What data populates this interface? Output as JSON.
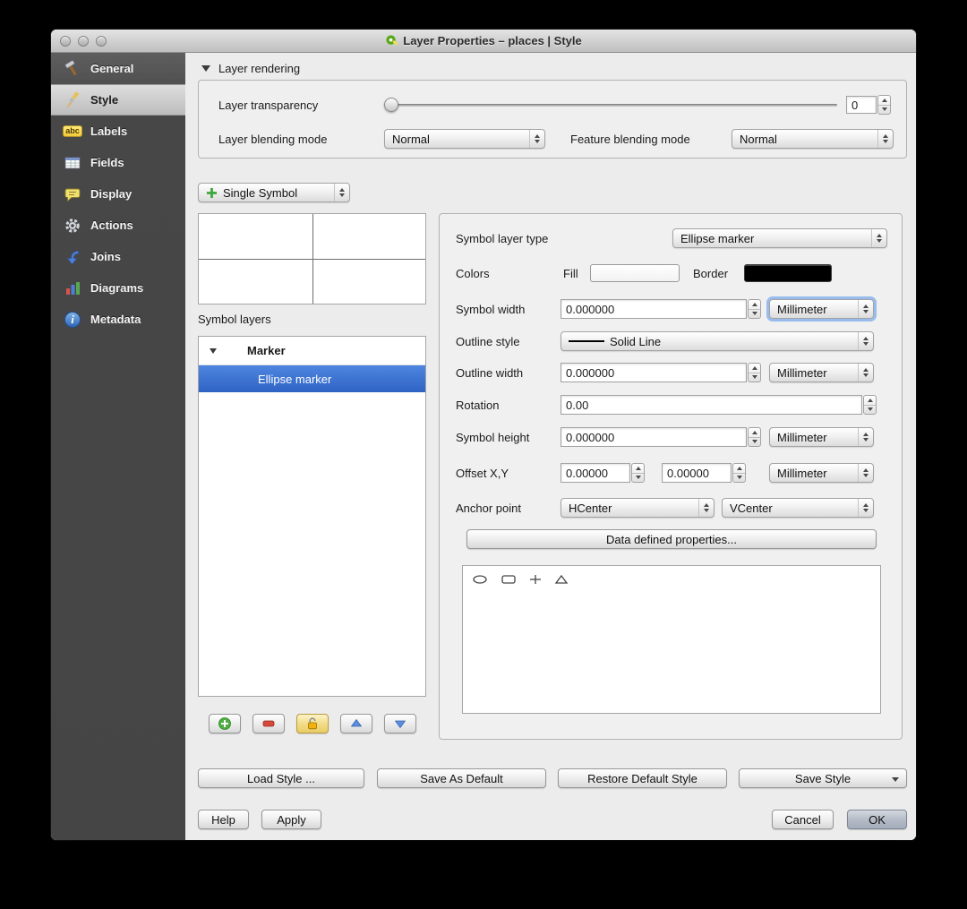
{
  "colors": {
    "selection_blue": "#3a76d8",
    "sidebar_bg": "#4a4a4a",
    "fill_swatch": "#ffffff",
    "border_swatch": "#000000"
  },
  "titlebar": {
    "title": "Layer Properties – places | Style"
  },
  "sidebar": {
    "items": [
      {
        "label": "General"
      },
      {
        "label": "Style"
      },
      {
        "label": "Labels",
        "icon_text": "abc"
      },
      {
        "label": "Fields"
      },
      {
        "label": "Display"
      },
      {
        "label": "Actions"
      },
      {
        "label": "Joins"
      },
      {
        "label": "Diagrams"
      },
      {
        "label": "Metadata",
        "icon_text": "i"
      }
    ]
  },
  "layer_rendering": {
    "header": "Layer rendering",
    "transparency": {
      "label": "Layer transparency",
      "value": "0"
    },
    "layer_blending": {
      "label": "Layer blending mode",
      "value": "Normal"
    },
    "feature_blending": {
      "label": "Feature blending mode",
      "value": "Normal"
    }
  },
  "symbol_section": {
    "renderer": "Single Symbol",
    "symbol_layers_label": "Symbol layers",
    "tree": {
      "group_label": "Marker",
      "selected_item": "Ellipse marker"
    }
  },
  "properties": {
    "symbol_layer_type": {
      "label": "Symbol layer type",
      "value": "Ellipse marker"
    },
    "colors": {
      "label": "Colors",
      "fill_label": "Fill",
      "border_label": "Border"
    },
    "symbol_width": {
      "label": "Symbol width",
      "value": "0.000000",
      "unit": "Millimeter"
    },
    "outline_style": {
      "label": "Outline style",
      "value": "Solid Line"
    },
    "outline_width": {
      "label": "Outline width",
      "value": "0.000000",
      "unit": "Millimeter"
    },
    "rotation": {
      "label": "Rotation",
      "value": "0.00"
    },
    "symbol_height": {
      "label": "Symbol height",
      "value": "0.000000",
      "unit": "Millimeter"
    },
    "offset": {
      "label": "Offset X,Y",
      "x_value": "0.00000",
      "y_value": "0.00000",
      "unit": "Millimeter"
    },
    "anchor": {
      "label": "Anchor point",
      "h_value": "HCenter",
      "v_value": "VCenter"
    },
    "data_defined_button": "Data defined properties..."
  },
  "style_buttons": {
    "load_style": "Load Style ...",
    "save_as_default": "Save As Default",
    "restore_default": "Restore Default Style",
    "save_style": "Save Style"
  },
  "dialog_buttons": {
    "help": "Help",
    "apply": "Apply",
    "cancel": "Cancel",
    "ok": "OK"
  }
}
